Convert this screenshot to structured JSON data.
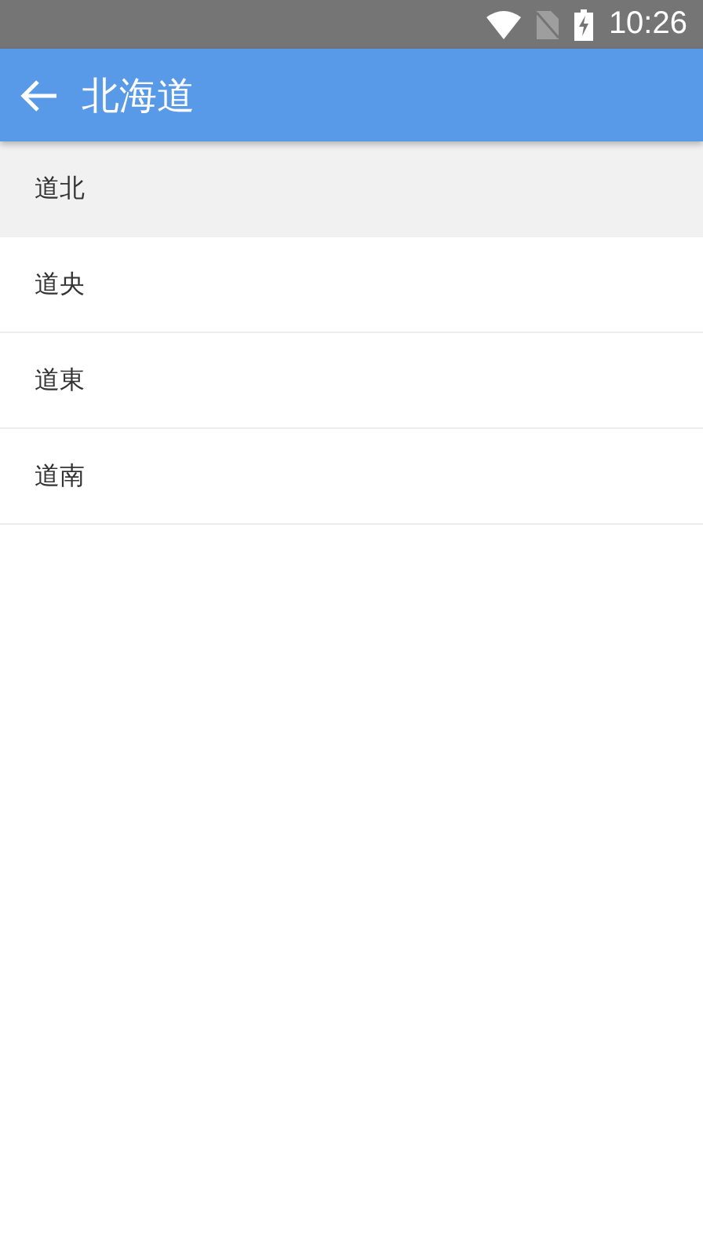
{
  "status_bar": {
    "time": "10:26"
  },
  "app_bar": {
    "title": "北海道"
  },
  "list": {
    "items": [
      {
        "label": "道北",
        "selected": true
      },
      {
        "label": "道央",
        "selected": false
      },
      {
        "label": "道東",
        "selected": false
      },
      {
        "label": "道南",
        "selected": false
      }
    ]
  }
}
